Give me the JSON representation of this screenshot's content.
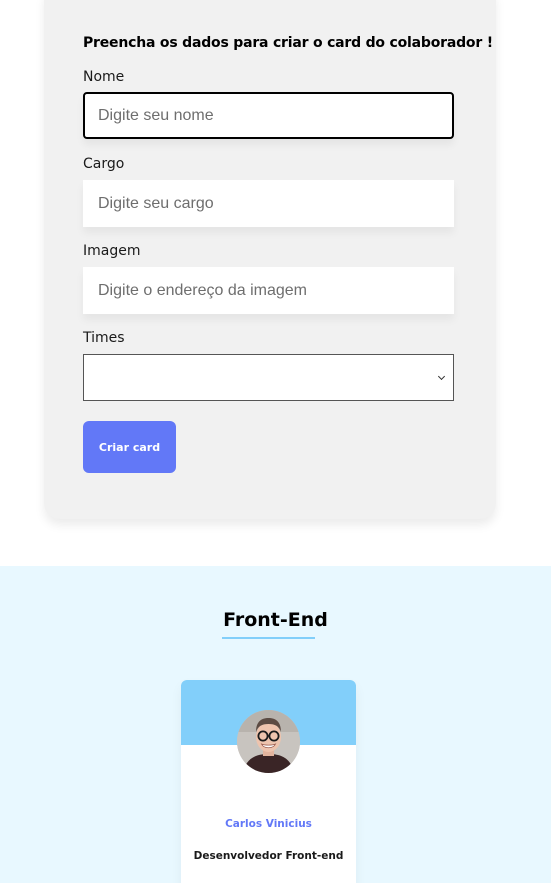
{
  "form": {
    "title": "Preencha os dados para criar o card do colaborador !",
    "fields": {
      "name": {
        "label": "Nome",
        "placeholder": "Digite seu nome",
        "value": ""
      },
      "role": {
        "label": "Cargo",
        "placeholder": "Digite seu cargo",
        "value": ""
      },
      "image": {
        "label": "Imagem",
        "placeholder": "Digite o endereço da imagem",
        "value": ""
      },
      "team": {
        "label": "Times",
        "selected": ""
      }
    },
    "submit_label": "Criar card"
  },
  "team_section": {
    "title": "Front-End",
    "background_color": "#e8f8ff",
    "accent_color": "#82cffa",
    "members": [
      {
        "name": "Carlos Vinicius",
        "role": "Desenvolvedor Front-end",
        "avatar": "person-photo"
      }
    ]
  },
  "colors": {
    "button": "#6278f7",
    "member_name": "#6278f7",
    "form_background": "#f1f1f1"
  }
}
